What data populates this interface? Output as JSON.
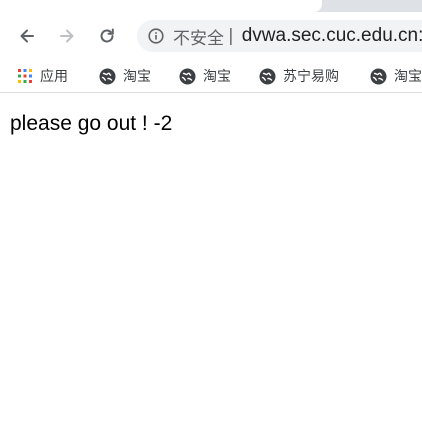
{
  "browser": {
    "address_bar": {
      "security_label": "不安全",
      "separator": "|",
      "url": "dvwa.sec.cuc.edu.cn:"
    },
    "bookmarks_bar": {
      "apps_label": "应用",
      "items": [
        {
          "label": "淘宝"
        },
        {
          "label": "淘宝"
        },
        {
          "label": "苏宁易购"
        },
        {
          "label": "淘宝"
        }
      ]
    }
  },
  "page": {
    "message": "please go out ! -2"
  }
}
